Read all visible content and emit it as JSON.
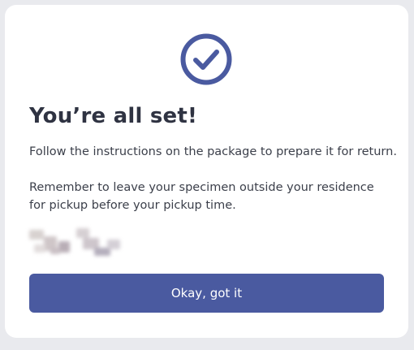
{
  "dialog": {
    "title": "You’re all set!",
    "paragraph_1": "Follow the instructions on the package to prepare it for return.",
    "paragraph_2": "Remember to leave your specimen outside your residence for pickup before your pickup time.",
    "icon": "check-circle-icon",
    "button_label": "Okay, got it"
  },
  "colors": {
    "accent": "#4a5aa0",
    "background": "#e9eaee",
    "card": "#ffffff",
    "title_text": "#2f3342",
    "body_text": "#3b3f4a"
  }
}
